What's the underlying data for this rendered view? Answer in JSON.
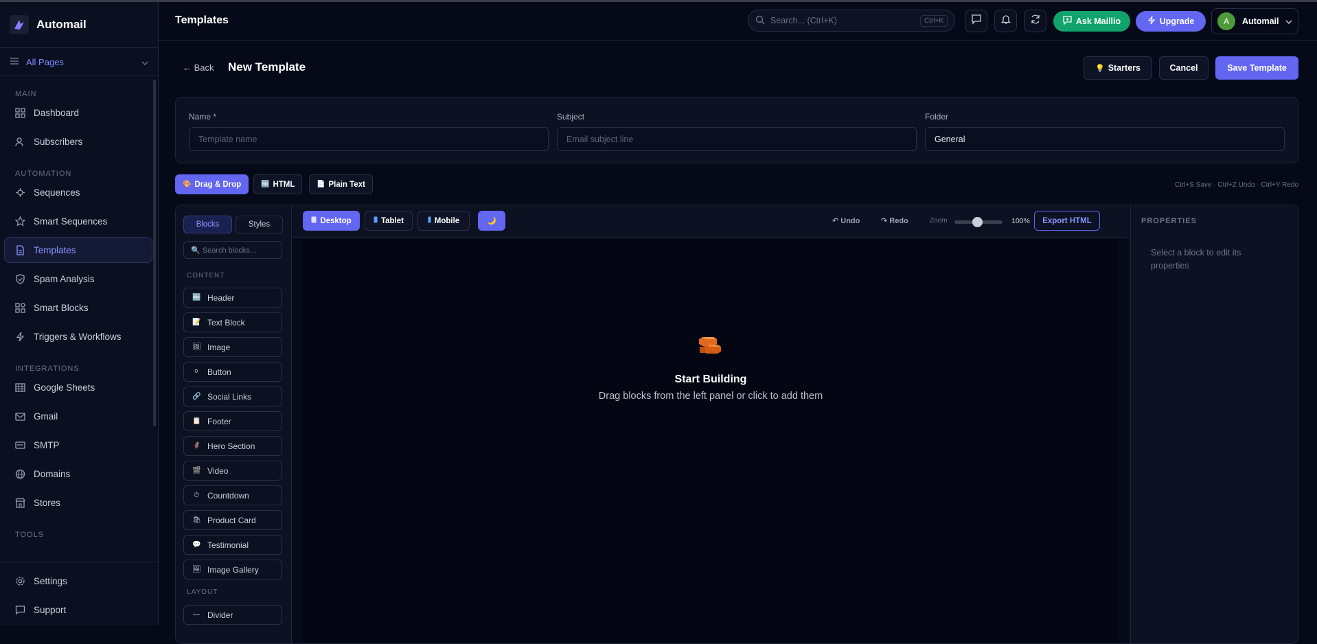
{
  "app": {
    "name": "Automail",
    "logo_icon": "automail-logo-icon"
  },
  "page_selector": {
    "label": "All Pages"
  },
  "sidebar": {
    "sections": [
      {
        "title": "MAIN",
        "items": [
          {
            "label": "Dashboard",
            "icon": "dashboard-icon"
          },
          {
            "label": "Subscribers",
            "icon": "users-icon"
          }
        ]
      },
      {
        "title": "AUTOMATION",
        "items": [
          {
            "label": "Sequences",
            "icon": "sequences-icon"
          },
          {
            "label": "Smart Sequences",
            "icon": "star-icon"
          },
          {
            "label": "Templates",
            "icon": "document-icon",
            "active": true
          },
          {
            "label": "Spam Analysis",
            "icon": "shield-icon"
          },
          {
            "label": "Smart Blocks",
            "icon": "blocks-icon"
          },
          {
            "label": "Triggers & Workflows",
            "icon": "lightning-icon"
          }
        ]
      },
      {
        "title": "INTEGRATIONS",
        "items": [
          {
            "label": "Google Sheets",
            "icon": "table-icon"
          },
          {
            "label": "Gmail",
            "icon": "mail-icon"
          },
          {
            "label": "SMTP",
            "icon": "smtp-icon"
          },
          {
            "label": "Domains",
            "icon": "globe-icon"
          },
          {
            "label": "Stores",
            "icon": "store-icon"
          }
        ]
      },
      {
        "title": "TOOLS",
        "items": []
      }
    ],
    "bottom": [
      {
        "label": "Settings",
        "icon": "gear-icon"
      },
      {
        "label": "Support",
        "icon": "chat-icon"
      }
    ]
  },
  "header": {
    "title": "Templates",
    "search_placeholder": "Search... (Ctrl+K)",
    "search_shortcut": "Ctrl+K",
    "ask_label": "Ask Maillio",
    "upgrade_label": "Upgrade",
    "user": {
      "initial": "A",
      "name": "Automail"
    }
  },
  "page": {
    "back_label": "← Back",
    "title": "New Template",
    "starters_label": "Starters",
    "cancel_label": "Cancel",
    "save_label": "Save Template"
  },
  "form": {
    "name_label": "Name *",
    "name_placeholder": "Template name",
    "subject_label": "Subject",
    "subject_placeholder": "Email subject line",
    "folder_label": "Folder",
    "folder_value": "General"
  },
  "modes": [
    {
      "label": "Drag & Drop",
      "icon": "🎨",
      "active": true
    },
    {
      "label": "HTML",
      "icon": "🆖"
    },
    {
      "label": "Plain Text",
      "icon": "📄"
    }
  ],
  "shortcuts_hint": "Ctrl+S Save · Ctrl+Z Undo · Ctrl+Y Redo",
  "blocks_panel": {
    "tabs": [
      "Blocks",
      "Styles"
    ],
    "search_placeholder": "🔍 Search blocks...",
    "content_title": "CONTENT",
    "content_blocks": [
      {
        "label": "Header",
        "icon": "🔤"
      },
      {
        "label": "Text Block",
        "icon": "📝"
      },
      {
        "label": "Image",
        "icon": "🖼"
      },
      {
        "label": "Button",
        "icon": "⚪"
      },
      {
        "label": "Social Links",
        "icon": "🔗"
      },
      {
        "label": "Footer",
        "icon": "📋"
      },
      {
        "label": "Hero Section",
        "icon": "🦸"
      },
      {
        "label": "Video",
        "icon": "🎬"
      },
      {
        "label": "Countdown",
        "icon": "⏱"
      },
      {
        "label": "Product Card",
        "icon": "🛍"
      },
      {
        "label": "Testimonial",
        "icon": "💬"
      },
      {
        "label": "Image Gallery",
        "icon": "🖼"
      }
    ],
    "layout_title": "LAYOUT",
    "layout_blocks": [
      {
        "label": "Divider",
        "icon": "—"
      }
    ]
  },
  "canvas_toolbar": {
    "devices": [
      "Desktop",
      "Tablet",
      "Mobile"
    ],
    "dark_toggle_icon": "🌙",
    "undo_label": "↶ Undo",
    "redo_label": "↷ Redo",
    "zoom_label": "Zoom",
    "zoom_value": "100%",
    "export_label": "Export HTML"
  },
  "canvas": {
    "empty_title": "Start Building",
    "empty_subtitle": "Drag blocks from the left panel or click to add them"
  },
  "properties": {
    "title": "PROPERTIES",
    "hint": "Select a block to edit its properties"
  },
  "colors": {
    "accent": "#6366f1",
    "ask_green": "#10a36b",
    "background": "#060a18"
  }
}
